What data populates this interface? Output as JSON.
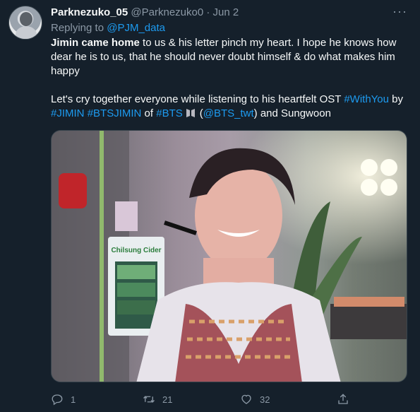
{
  "tweet": {
    "display_name": "Parknezuko_05",
    "handle": "@Parknezuko0",
    "separator": "·",
    "date": "Jun 2",
    "more": "···",
    "replying_prefix": "Replying to",
    "replying_to": "@PJM_data",
    "p1_bold": "Jimin came home",
    "p1_rest": " to us & his letter pinch my heart. I hope he knows how dear he is to us, that he should never doubt himself & do what makes him happy",
    "p2_start": "Let's cry together everyone while listening to his heartfelt OST ",
    "hashtag_withyou": "#WithYou",
    "by": " by",
    "hashtag_jimin": "#JIMIN",
    "hashtag_btsjimin": "#BTSJIMIN",
    "of": " of ",
    "hashtag_bts": "#BTS",
    "paren_open": "(",
    "mention_bts": "@BTS_twt",
    "paren_close_rest": ") and Sungwoon"
  },
  "media": {
    "sign_text": "Chilsung Cider"
  },
  "actions": {
    "reply_count": "1",
    "retweet_count": "21",
    "like_count": "32"
  },
  "icons": {
    "reply": "reply-icon",
    "retweet": "retweet-icon",
    "like": "heart-icon",
    "share": "share-icon",
    "bts": "bts-logo-icon"
  },
  "colors": {
    "background": "#15202b",
    "link": "#1d9bf0",
    "secondary_text": "#8b98a5"
  }
}
